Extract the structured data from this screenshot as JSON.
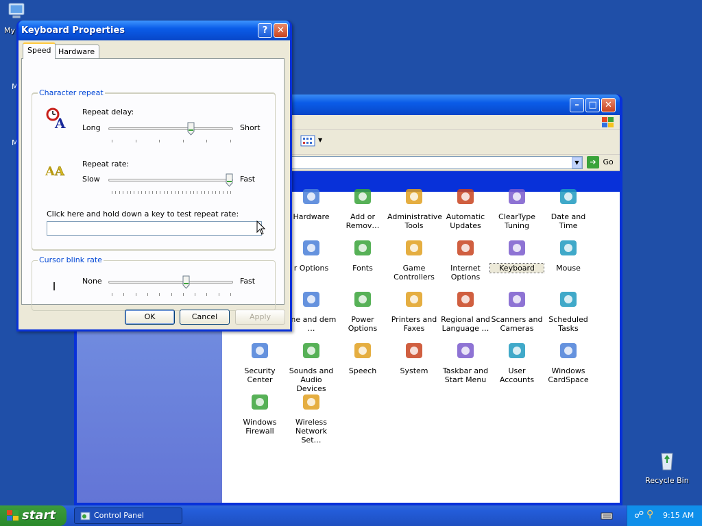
{
  "desktop": {
    "icons": [
      {
        "label": "My"
      },
      {
        "label": "M"
      },
      {
        "label": "M"
      },
      {
        "label": "Recycle Bin"
      }
    ]
  },
  "control_panel": {
    "address_go": "Go",
    "items": [
      {
        "label": "Hardware",
        "icon": "hardware-icon"
      },
      {
        "label": "Add or Remov…",
        "icon": "add-remove-icon"
      },
      {
        "label": "Administrative Tools",
        "icon": "admin-tools-icon"
      },
      {
        "label": "Automatic Updates",
        "icon": "windows-update-icon"
      },
      {
        "label": "ClearType Tuning",
        "icon": "cleartype-icon"
      },
      {
        "label": "Date and Time",
        "icon": "clock-icon"
      },
      {
        "label": "r Options",
        "icon": "folder-options-icon"
      },
      {
        "label": "Fonts",
        "icon": "fonts-folder-icon"
      },
      {
        "label": "Game Controllers",
        "icon": "gamepad-icon"
      },
      {
        "label": "Internet Options",
        "icon": "globe-icon"
      },
      {
        "label": "Keyboard",
        "icon": "keyboard-icon",
        "selected": true
      },
      {
        "label": "Mouse",
        "icon": "mouse-icon"
      },
      {
        "label": "one and dem …",
        "icon": "phone-modem-icon"
      },
      {
        "label": "Power Options",
        "icon": "power-icon"
      },
      {
        "label": "Printers and Faxes",
        "icon": "printer-icon"
      },
      {
        "label": "Regional and Language …",
        "icon": "regional-globe-icon"
      },
      {
        "label": "Scanners and Cameras",
        "icon": "scanner-icon"
      },
      {
        "label": "Scheduled Tasks",
        "icon": "scheduled-tasks-icon"
      },
      {
        "label": "Security Center",
        "icon": "shield-icon"
      },
      {
        "label": "Sounds and Audio Devices",
        "icon": "speaker-icon"
      },
      {
        "label": "Speech",
        "icon": "speech-icon"
      },
      {
        "label": "System",
        "icon": "system-icon"
      },
      {
        "label": "Taskbar and Start Menu",
        "icon": "taskbar-icon"
      },
      {
        "label": "User Accounts",
        "icon": "users-icon"
      },
      {
        "label": "Windows CardSpace",
        "icon": "cardspace-icon"
      },
      {
        "label": "Windows Firewall",
        "icon": "firewall-icon"
      },
      {
        "label": "Wireless Network Set…",
        "icon": "wireless-icon"
      }
    ]
  },
  "dialog": {
    "title": "Keyboard Properties",
    "tabs": [
      "Speed",
      "Hardware"
    ],
    "character_repeat": {
      "title": "Character repeat",
      "repeat_delay_label": "Repeat delay:",
      "delay_min": "Long",
      "delay_max": "Short",
      "delay_value": 0.67,
      "repeat_rate_label": "Repeat rate:",
      "rate_min": "Slow",
      "rate_max": "Fast",
      "rate_value": 1.0,
      "test_label": "Click here and hold down a key to test repeat rate:",
      "test_value": ""
    },
    "cursor_blink": {
      "title": "Cursor blink rate",
      "min": "None",
      "max": "Fast",
      "value": 0.63
    },
    "buttons": {
      "ok": "OK",
      "cancel": "Cancel",
      "apply": "Apply"
    }
  },
  "taskbar": {
    "start": "start",
    "task_label": "Control Panel",
    "time": "9:15 AM"
  }
}
